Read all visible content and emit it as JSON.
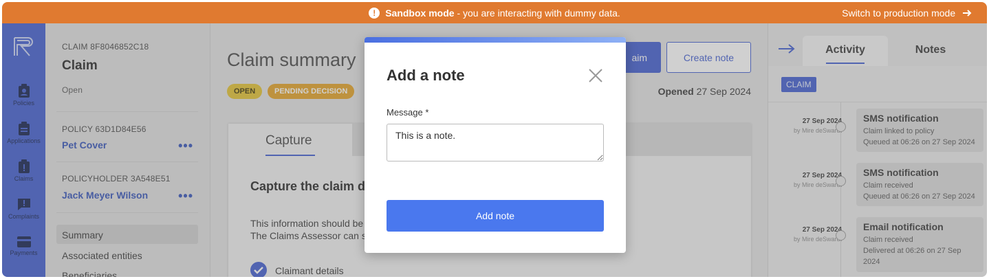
{
  "banner": {
    "icon": "warning-icon",
    "mode": "Sandbox mode",
    "message": " - you are interacting with dummy data.",
    "switch_label": "Switch to production mode",
    "switch_icon": "arrow-right-icon",
    "bg_color": "#e07a30"
  },
  "rail": {
    "logo_icon": "brand-logo-icon",
    "items": [
      {
        "label": "Policies",
        "icon": "clipboard-person-icon"
      },
      {
        "label": "Applications",
        "icon": "clipboard-list-icon"
      },
      {
        "label": "Claims",
        "icon": "clipboard-alert-icon"
      },
      {
        "label": "Complaints",
        "icon": "chat-alert-icon"
      },
      {
        "label": "Payments",
        "icon": "credit-card-icon"
      }
    ],
    "bg_color": "#3d5ad0"
  },
  "sidebar": {
    "claim_id": "CLAIM 8F8046852C18",
    "claim_title": "Claim",
    "claim_status": "Open",
    "policy_id": "POLICY 63D1D84E56",
    "policy_name": "Pet Cover",
    "policyholder_id": "POLICYHOLDER 3A548E51",
    "policyholder_name": "Jack Meyer Wilson",
    "more_glyph": "•••",
    "nav": [
      "Summary",
      "Associated entities",
      "Beneficiaries"
    ]
  },
  "main": {
    "title": "Claim summary",
    "badges": [
      "OPEN",
      "PENDING DECISION"
    ],
    "primary_button_fragment": "aim",
    "create_note_label": "Create note",
    "opened_label": "Opened",
    "opened_date": "27 Sep 2024",
    "card": {
      "tab_label": "Capture",
      "heading": "Capture the claim d",
      "info_line1": "This information should be c",
      "info_line2": "The Claims Assessor can sti",
      "step_label": "Claimant details"
    }
  },
  "right": {
    "collapse_icon": "arrow-right-icon",
    "tabs": [
      "Activity",
      "Notes"
    ],
    "active_tab": "Activity",
    "filter_badge": "CLAIM",
    "timeline": [
      {
        "date": "27 Sep 2024",
        "by": "by Mire deSwardt",
        "title": "SMS notification",
        "line1": "Claim linked to policy",
        "line2": "Queued at 06:26 on 27 Sep 2024"
      },
      {
        "date": "27 Sep 2024",
        "by": "by Mire deSwardt",
        "title": "SMS notification",
        "line1": "Claim received",
        "line2": "Queued at 06:26 on 27 Sep 2024"
      },
      {
        "date": "27 Sep 2024",
        "by": "by Mire deSwardt",
        "title": "Email notification",
        "line1": "Claim received",
        "line2": "Delivered at 06:26 on 27 Sep 2024"
      }
    ]
  },
  "modal": {
    "title": "Add a note",
    "close_icon": "close-icon",
    "message_label": "Message *",
    "message_value": "This is a note.",
    "submit_label": "Add note",
    "accent_color": "#4a78ee"
  }
}
